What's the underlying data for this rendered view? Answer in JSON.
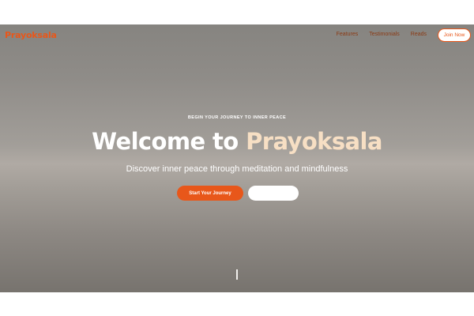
{
  "nav": {
    "brand": "Prayoksala",
    "links": [
      "Features",
      "Testimonials",
      "Reads"
    ],
    "join_label": "Join Now"
  },
  "hero": {
    "eyebrow": "BEGIN YOUR JOURNEY TO INNER PEACE",
    "headline_part1": "Welcome to",
    "headline_part2": "Prayoksala",
    "subtitle": "Discover inner peace through meditation and mindfulness",
    "primary_cta": "Start Your Journey",
    "secondary_cta": ""
  },
  "colors": {
    "accent": "#e8571a",
    "headline_highlight": "#f7dfc4",
    "hero_bg_mid": "#b0aaa4"
  },
  "icons": {
    "scroll": "scroll-indicator-line"
  }
}
